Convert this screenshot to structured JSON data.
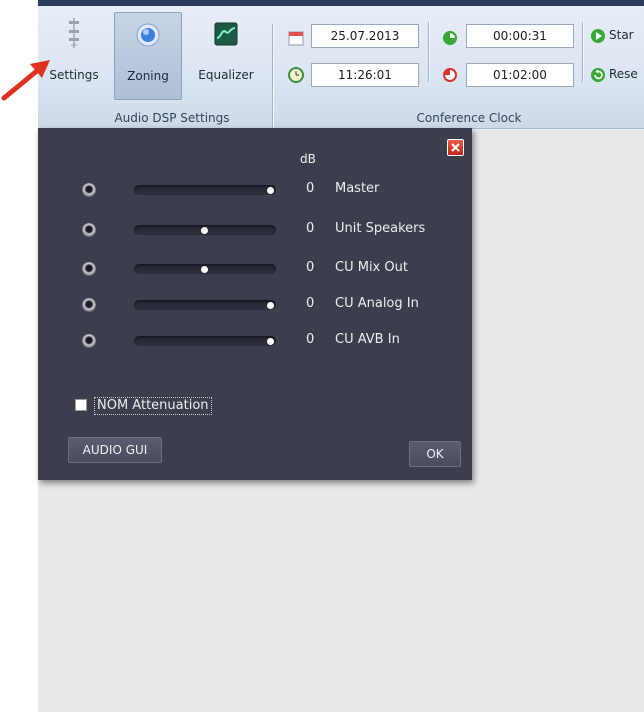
{
  "ribbon": {
    "audio_group": {
      "caption": "Audio DSP Settings",
      "buttons": [
        {
          "label": "Settings",
          "icon": "sliders-icon"
        },
        {
          "label": "Zoning",
          "icon": "zoning-orb-icon",
          "selected": true
        },
        {
          "label": "Equalizer",
          "icon": "equalizer-icon"
        }
      ]
    },
    "clock_group": {
      "caption": "Conference Clock",
      "date": "25.07.2013",
      "time": "11:26:01",
      "elapsed": "00:00:31",
      "remaining": "01:02:00",
      "start_label": "Star",
      "reset_label": "Rese"
    }
  },
  "dialog": {
    "db_header": "dB",
    "channels": [
      {
        "name": "Master",
        "db": "0",
        "level": 1.0
      },
      {
        "name": "Unit Speakers",
        "db": "0",
        "level": 0.5
      },
      {
        "name": "CU Mix Out",
        "db": "0",
        "level": 0.5
      },
      {
        "name": "CU Analog In",
        "db": "0",
        "level": 1.0
      },
      {
        "name": "CU AVB In",
        "db": "0",
        "level": 1.0
      }
    ],
    "nom_attenuation_label": "NOM Attenuation",
    "nom_attenuation_checked": false,
    "audio_gui_label": "AUDIO GUI",
    "ok_label": "OK"
  },
  "colors": {
    "dialog_bg": "#3c3e4e",
    "ribbon_bg": "#dbe4f0",
    "arrow": "#e0301e"
  }
}
